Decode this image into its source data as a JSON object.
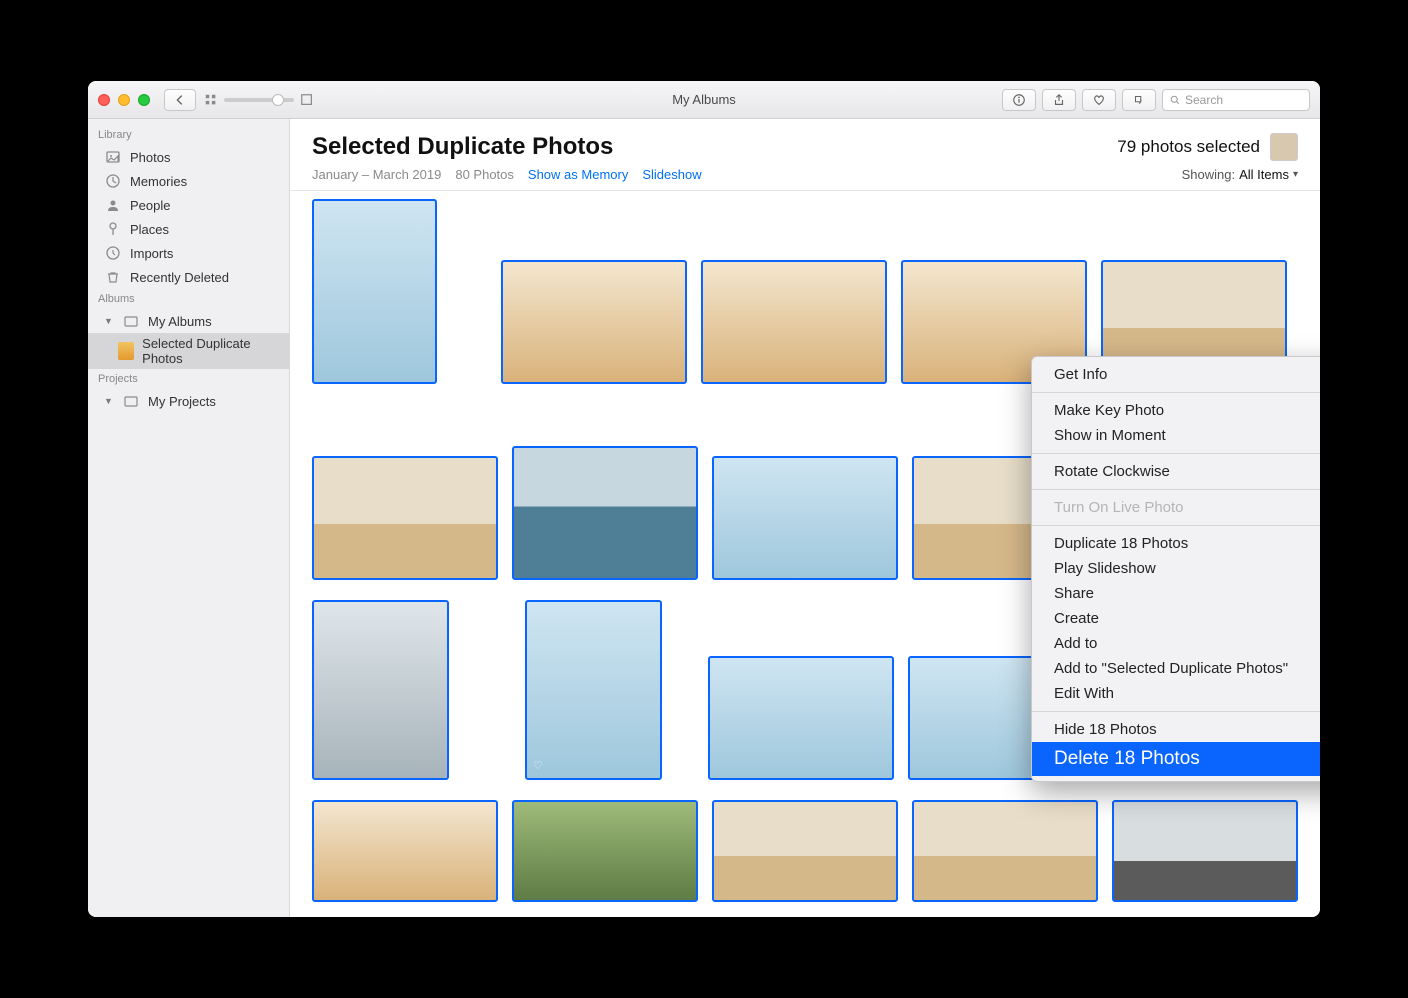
{
  "window": {
    "title": "My Albums"
  },
  "toolbar": {
    "search_placeholder": "Search"
  },
  "sidebar": {
    "sections": {
      "library": "Library",
      "albums": "Albums",
      "projects": "Projects"
    },
    "library_items": [
      {
        "label": "Photos"
      },
      {
        "label": "Memories"
      },
      {
        "label": "People"
      },
      {
        "label": "Places"
      },
      {
        "label": "Imports"
      },
      {
        "label": "Recently Deleted"
      }
    ],
    "albums_items": [
      {
        "label": "My Albums"
      },
      {
        "label": "Selected Duplicate Photos",
        "selected": true
      }
    ],
    "projects_items": [
      {
        "label": "My Projects"
      }
    ]
  },
  "header": {
    "title": "Selected Duplicate Photos",
    "date_range": "January – March 2019",
    "count": "80 Photos",
    "show_as_memory": "Show as Memory",
    "slideshow": "Slideshow",
    "selected": "79 photos selected",
    "showing_label": "Showing:",
    "showing_value": "All Items"
  },
  "context_menu": {
    "get_info": "Get Info",
    "make_key": "Make Key Photo",
    "show_moment": "Show in Moment",
    "rotate": "Rotate Clockwise",
    "live_photo": "Turn On Live Photo",
    "duplicate": "Duplicate 18 Photos",
    "play_slideshow": "Play Slideshow",
    "share": "Share",
    "create": "Create",
    "add_to": "Add to",
    "add_to_album": "Add to \"Selected Duplicate Photos\"",
    "edit_with": "Edit With",
    "hide": "Hide 18 Photos",
    "delete": "Delete 18 Photos"
  }
}
